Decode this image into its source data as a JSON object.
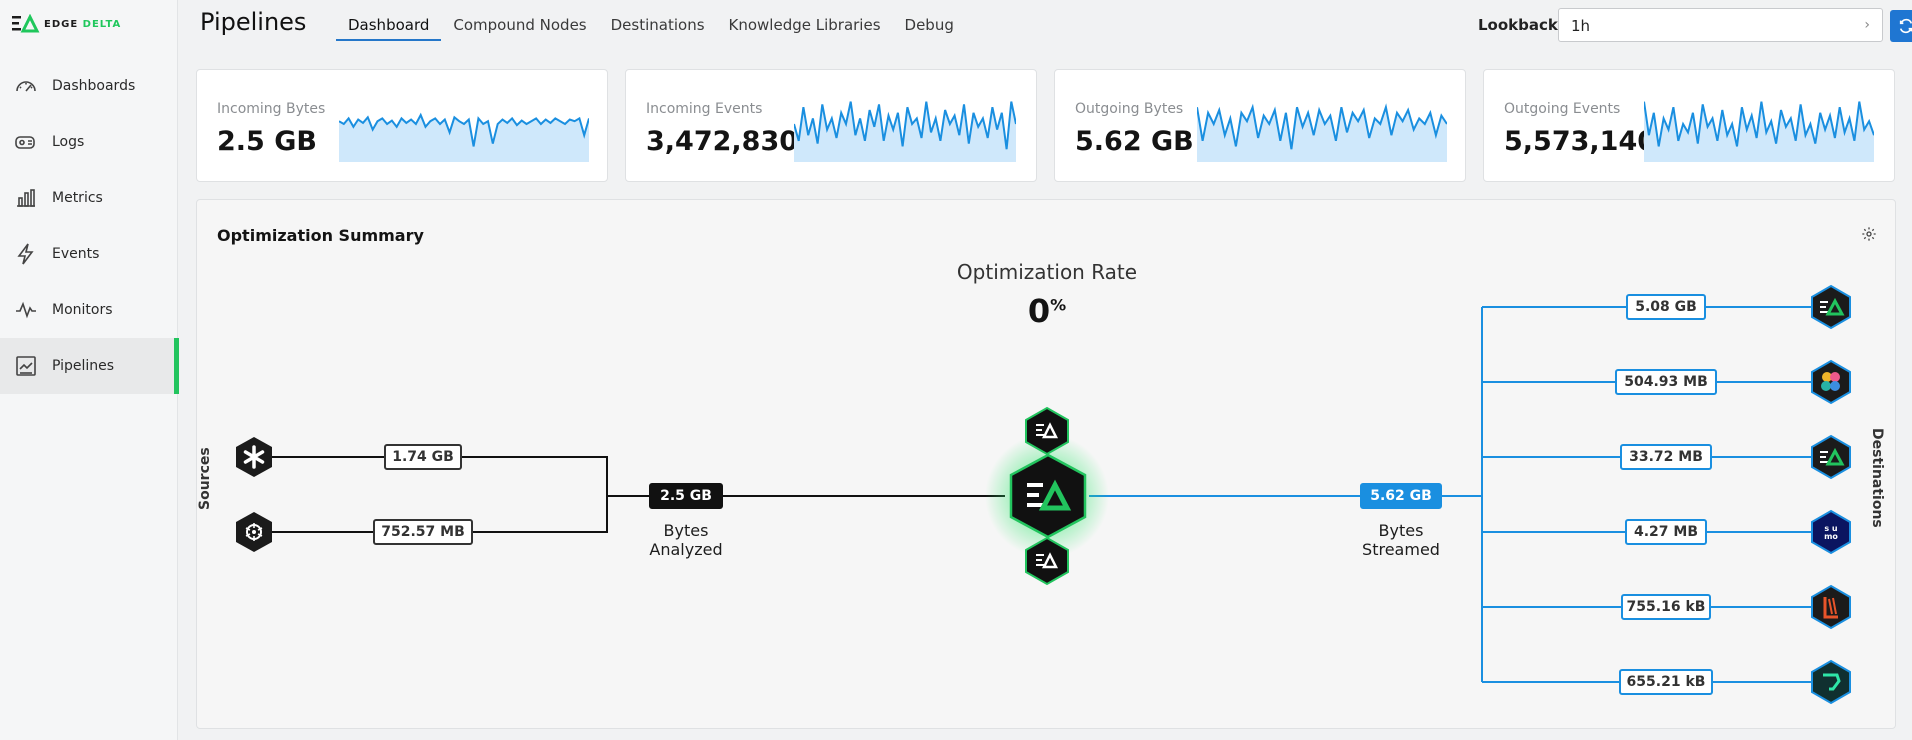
{
  "brand": {
    "logo_text_a": "EDGE ",
    "logo_text_b": "DELTA"
  },
  "sidebar": {
    "items": [
      {
        "label": "Dashboards",
        "icon": "gauge-icon"
      },
      {
        "label": "Logs",
        "icon": "logs-icon"
      },
      {
        "label": "Metrics",
        "icon": "bar-chart-icon"
      },
      {
        "label": "Events",
        "icon": "lightning-icon"
      },
      {
        "label": "Monitors",
        "icon": "pulse-icon"
      },
      {
        "label": "Pipelines",
        "icon": "pipeline-icon",
        "active": true
      }
    ]
  },
  "header": {
    "title": "Pipelines",
    "tabs": [
      {
        "label": "Dashboard",
        "active": true
      },
      {
        "label": "Compound Nodes"
      },
      {
        "label": "Destinations"
      },
      {
        "label": "Knowledge Libraries"
      },
      {
        "label": "Debug"
      }
    ],
    "lookback_label": "Lookback:",
    "lookback_value": "1h"
  },
  "metrics": [
    {
      "label": "Incoming Bytes",
      "value": "2.5 GB",
      "spark": [
        0.55,
        0.5,
        0.6,
        0.45,
        0.58,
        0.52,
        0.62,
        0.4,
        0.55,
        0.6,
        0.5,
        0.56,
        0.45,
        0.6,
        0.52,
        0.58,
        0.5,
        0.66,
        0.45,
        0.55,
        0.6,
        0.5,
        0.58,
        0.35,
        0.62,
        0.55,
        0.5,
        0.58,
        0.1,
        0.6,
        0.5,
        0.55,
        0.15,
        0.5,
        0.58,
        0.52,
        0.6,
        0.48,
        0.56,
        0.5,
        0.55,
        0.6,
        0.5,
        0.58,
        0.52,
        0.6,
        0.55,
        0.5,
        0.58,
        0.55,
        0.6,
        0.3,
        0.6
      ]
    },
    {
      "label": "Incoming Events",
      "value": "3,472,830",
      "spark": [
        0.5,
        0.2,
        0.8,
        0.3,
        0.6,
        0.15,
        0.85,
        0.4,
        0.6,
        0.25,
        0.7,
        0.5,
        0.9,
        0.3,
        0.6,
        0.2,
        0.75,
        0.45,
        0.85,
        0.2,
        0.65,
        0.4,
        0.7,
        0.1,
        0.8,
        0.5,
        0.6,
        0.25,
        0.9,
        0.35,
        0.6,
        0.2,
        0.75,
        0.5,
        0.65,
        0.3,
        0.85,
        0.15,
        0.7,
        0.45,
        0.6,
        0.25,
        0.8,
        0.4,
        0.7,
        0.05,
        0.9,
        0.5
      ]
    },
    {
      "label": "Outgoing Bytes",
      "value": "5.62 GB",
      "spark": [
        0.8,
        0.2,
        0.7,
        0.5,
        0.75,
        0.3,
        0.6,
        0.1,
        0.7,
        0.55,
        0.8,
        0.25,
        0.65,
        0.5,
        0.75,
        0.2,
        0.7,
        0.05,
        0.8,
        0.45,
        0.7,
        0.3,
        0.75,
        0.5,
        0.65,
        0.2,
        0.8,
        0.35,
        0.7,
        0.55,
        0.75,
        0.25,
        0.6,
        0.5,
        0.8,
        0.3,
        0.7,
        0.55,
        0.75,
        0.4,
        0.6,
        0.5,
        0.7,
        0.3,
        0.65,
        0.5
      ]
    },
    {
      "label": "Outgoing Events",
      "value": "5,573,140",
      "spark": [
        0.9,
        0.3,
        0.7,
        0.1,
        0.6,
        0.4,
        0.8,
        0.2,
        0.5,
        0.35,
        0.7,
        0.15,
        0.85,
        0.45,
        0.6,
        0.2,
        0.75,
        0.3,
        0.5,
        0.1,
        0.8,
        0.4,
        0.65,
        0.25,
        0.9,
        0.35,
        0.55,
        0.15,
        0.75,
        0.45,
        0.6,
        0.2,
        0.85,
        0.3,
        0.5,
        0.15,
        0.7,
        0.4,
        0.65,
        0.25,
        0.8,
        0.35,
        0.6,
        0.2,
        0.9,
        0.4,
        0.55,
        0.3
      ]
    }
  ],
  "panel": {
    "title": "Optimization Summary",
    "opt_rate_label": "Optimization Rate",
    "opt_rate_value": "0",
    "opt_rate_unit": "%",
    "sources_label": "Sources",
    "destinations_label": "Destinations",
    "sources": [
      {
        "value": "1.74 GB",
        "icon": "asterisk-icon"
      },
      {
        "value": "752.57 MB",
        "icon": "kubernetes-icon"
      }
    ],
    "analyzed_value": "2.5 GB",
    "analyzed_caption_1": "Bytes",
    "analyzed_caption_2": "Analyzed",
    "streamed_value": "5.62 GB",
    "streamed_caption_1": "Bytes",
    "streamed_caption_2": "Streamed",
    "destinations": [
      {
        "value": "5.08 GB",
        "icon": "edgedelta-icon"
      },
      {
        "value": "504.93 MB",
        "icon": "elastic-icon"
      },
      {
        "value": "33.72 MB",
        "icon": "edgedelta-icon"
      },
      {
        "value": "4.27 MB",
        "icon": "sumo-logic-icon"
      },
      {
        "value": "755.16 kB",
        "icon": "splunk-icon"
      },
      {
        "value": "655.21 kB",
        "icon": "hook-icon"
      }
    ]
  },
  "colors": {
    "accent": "#1f76d2",
    "green": "#22c45e",
    "blue_line": "#1a8fe0"
  }
}
